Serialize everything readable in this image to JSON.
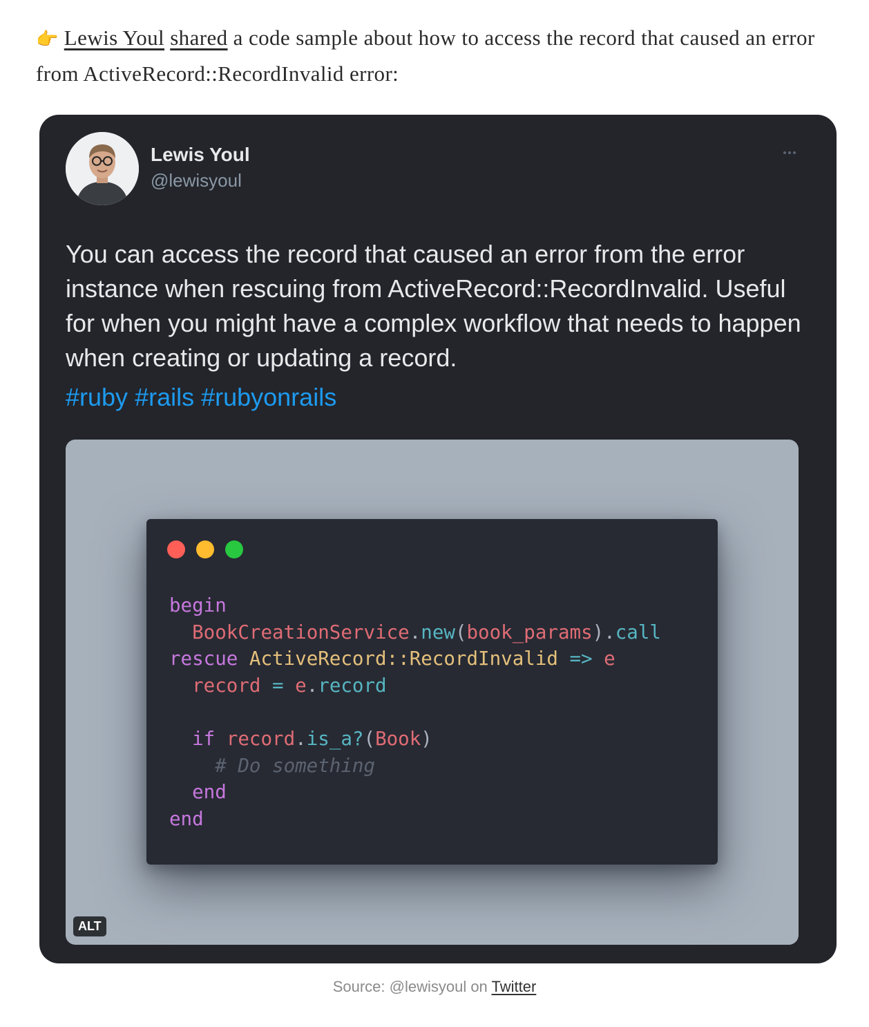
{
  "intro": {
    "pointer_emoji": "👉",
    "author_link": "Lewis Youl",
    "shared_link": "shared",
    "text_part1": " a code sample about how to access the record that caused an error from ActiveRecord::RecordInvalid error:"
  },
  "tweet": {
    "author_name": "Lewis Youl",
    "author_handle": "@lewisyoul",
    "body": "You can access the record that caused an error from the error instance when rescuing from ActiveRecord::RecordInvalid. Useful for when you might have a complex workflow that needs to happen when creating or updating a record.",
    "hashtags": [
      "#ruby",
      "#rails",
      "#rubyonrails"
    ],
    "alt_badge": "ALT"
  },
  "code": {
    "lines": [
      {
        "tokens": [
          {
            "t": "begin",
            "c": "kw"
          }
        ]
      },
      {
        "tokens": [
          {
            "t": "  ",
            "c": "punc"
          },
          {
            "t": "BookCreationService",
            "c": "cls"
          },
          {
            "t": ".",
            "c": "punc"
          },
          {
            "t": "new",
            "c": "fn"
          },
          {
            "t": "(",
            "c": "punc"
          },
          {
            "t": "book_params",
            "c": "var"
          },
          {
            "t": ").",
            "c": "punc"
          },
          {
            "t": "call",
            "c": "fn"
          }
        ]
      },
      {
        "tokens": [
          {
            "t": "rescue ",
            "c": "kw"
          },
          {
            "t": "ActiveRecord::RecordInvalid",
            "c": "const"
          },
          {
            "t": " => ",
            "c": "op"
          },
          {
            "t": "e",
            "c": "var"
          }
        ]
      },
      {
        "tokens": [
          {
            "t": "  ",
            "c": "punc"
          },
          {
            "t": "record",
            "c": "var"
          },
          {
            "t": " = ",
            "c": "op"
          },
          {
            "t": "e",
            "c": "var"
          },
          {
            "t": ".",
            "c": "punc"
          },
          {
            "t": "record",
            "c": "fn"
          }
        ]
      },
      {
        "tokens": []
      },
      {
        "tokens": [
          {
            "t": "  ",
            "c": "punc"
          },
          {
            "t": "if ",
            "c": "kw"
          },
          {
            "t": "record",
            "c": "var"
          },
          {
            "t": ".",
            "c": "punc"
          },
          {
            "t": "is_a?",
            "c": "fn"
          },
          {
            "t": "(",
            "c": "punc"
          },
          {
            "t": "Book",
            "c": "cls"
          },
          {
            "t": ")",
            "c": "punc"
          }
        ]
      },
      {
        "tokens": [
          {
            "t": "    # Do something",
            "c": "cmt"
          }
        ]
      },
      {
        "tokens": [
          {
            "t": "  ",
            "c": "punc"
          },
          {
            "t": "end",
            "c": "kw"
          }
        ]
      },
      {
        "tokens": [
          {
            "t": "end",
            "c": "kw"
          }
        ]
      }
    ]
  },
  "source": {
    "prefix": "Source: @lewisyoul on ",
    "link": "Twitter"
  },
  "colors": {
    "card_bg": "#23252b",
    "hashtag": "#1d9bf0",
    "media_bg": "#a7b1bc",
    "code_bg": "#272a33"
  }
}
